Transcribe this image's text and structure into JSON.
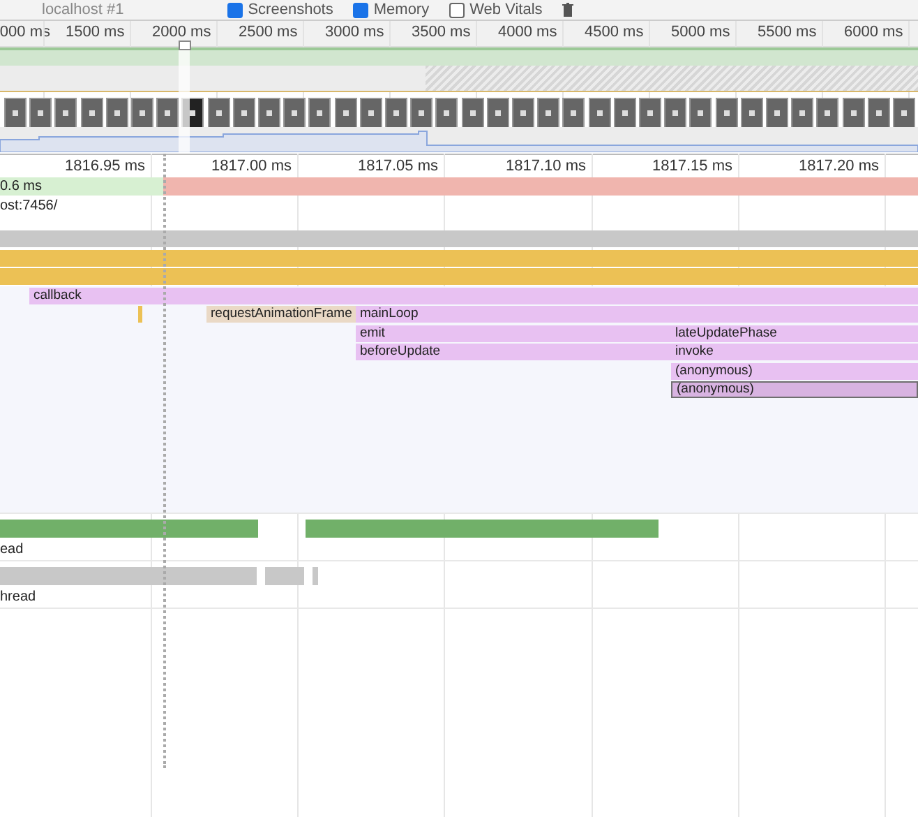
{
  "toolbar": {
    "recording": "localhost #1",
    "options": [
      {
        "label": "Screenshots",
        "checked": true
      },
      {
        "label": "Memory",
        "checked": true
      },
      {
        "label": "Web Vitals",
        "checked": false
      }
    ]
  },
  "overview": {
    "ticks": [
      "000 ms",
      "1500 ms",
      "2000 ms",
      "2500 ms",
      "3000 ms",
      "3500 ms",
      "4000 ms",
      "4500 ms",
      "5000 ms",
      "5500 ms",
      "6000 ms"
    ]
  },
  "ruler": {
    "ticks": [
      "1816.95 ms",
      "1817.00 ms",
      "1817.05 ms",
      "1817.10 ms",
      "1817.15 ms",
      "1817.20 ms"
    ]
  },
  "frames": [
    {
      "label": "0.6 ms",
      "kind": "good"
    },
    {
      "kind": "dropped"
    }
  ],
  "network": {
    "label": "ost:7456/"
  },
  "flame": [
    [
      {
        "kind": "task",
        "selected": false
      }
    ],
    [
      {
        "kind": "script",
        "selected": false
      }
    ],
    [
      {
        "kind": "script",
        "selected": false
      }
    ],
    [
      {
        "label": "callback",
        "kind": "function",
        "selected": false
      }
    ],
    [
      {
        "kind": "script",
        "selected": false
      },
      {
        "label": "requestAnimationFrame",
        "kind": "animation",
        "selected": false
      },
      {
        "label": "mainLoop",
        "kind": "function",
        "selected": false
      }
    ],
    [
      {
        "label": "emit",
        "kind": "function",
        "selected": false
      },
      {
        "label": "lateUpdatePhase",
        "kind": "function",
        "selected": false
      }
    ],
    [
      {
        "label": "beforeUpdate",
        "kind": "function",
        "selected": false
      },
      {
        "label": "invoke",
        "kind": "function",
        "selected": false
      }
    ],
    [
      {
        "label": "(anonymous)",
        "kind": "function",
        "selected": false
      }
    ],
    [
      {
        "label": "(anonymous)",
        "kind": "function",
        "selected": true
      }
    ]
  ],
  "threads": [
    {
      "label": "ead",
      "kind": "gpu"
    },
    {
      "label": "hread",
      "kind": "raster"
    }
  ]
}
